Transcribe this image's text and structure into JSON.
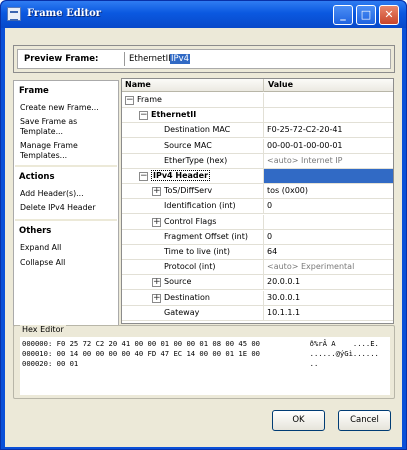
{
  "window": {
    "title": "Frame Editor"
  },
  "titlebar_buttons": {
    "minimize": "_",
    "maximize": "□",
    "close": "✕"
  },
  "preview": {
    "label": "Preview Frame:",
    "frames": [
      {
        "label": "EthernetII",
        "selected": false
      },
      {
        "label": "IPv4",
        "selected": true
      }
    ]
  },
  "left_panel": {
    "groups": [
      {
        "header": "Frame",
        "items": [
          "Create new Frame...",
          "Save Frame as Template...",
          "Manage Frame Templates..."
        ]
      },
      {
        "header": "Actions",
        "items": [
          "Add Header(s)...",
          "Delete IPv4 Header"
        ]
      },
      {
        "header": "Others",
        "items": [
          "Expand All",
          "Collapse All"
        ]
      }
    ]
  },
  "grid": {
    "columns": {
      "name": "Name",
      "value": "Value"
    },
    "rows": [
      {
        "name": "Frame",
        "value": "",
        "expander": "−"
      },
      {
        "name": "EthernetII",
        "value": "",
        "expander": "−"
      },
      {
        "name": "Destination MAC",
        "value": "F0-25-72-C2-20-41"
      },
      {
        "name": "Source MAC",
        "value": "00-00-01-00-00-01"
      },
      {
        "name": "EtherType (hex)",
        "value": "<auto> Internet IP"
      },
      {
        "name": "IPv4 Header",
        "value": "",
        "expander": "−",
        "selected": true
      },
      {
        "name": "ToS/DiffServ",
        "value": "tos (0x00)",
        "expander": "+"
      },
      {
        "name": "Identification (int)",
        "value": "0"
      },
      {
        "name": "Control Flags",
        "value": "",
        "expander": "+"
      },
      {
        "name": "Fragment Offset (int)",
        "value": "0"
      },
      {
        "name": "Time to live (int)",
        "value": "64"
      },
      {
        "name": "Protocol (int)",
        "value": "<auto> Experimental"
      },
      {
        "name": "Source",
        "value": "20.0.0.1",
        "expander": "+"
      },
      {
        "name": "Destination",
        "value": "30.0.0.1",
        "expander": "+"
      },
      {
        "name": "Gateway",
        "value": "10.1.1.1"
      }
    ]
  },
  "hex_editor": {
    "label": "Hex Editor",
    "lines": [
      {
        "offset": "000000:",
        "bytes": "F0 25 72 C2 20 41 00 00 01 00 00 01 08 00 45 00",
        "ascii": "ð%rÂ A    ....E."
      },
      {
        "offset": "000010:",
        "bytes": "00 14 00 00 00 00 40 FD 47 EC 14 00 00 01 1E 00",
        "ascii": "......@ýGì......"
      },
      {
        "offset": "000020:",
        "bytes": "00 01",
        "ascii": ".."
      }
    ]
  },
  "buttons": {
    "ok": "OK",
    "cancel": "Cancel"
  }
}
